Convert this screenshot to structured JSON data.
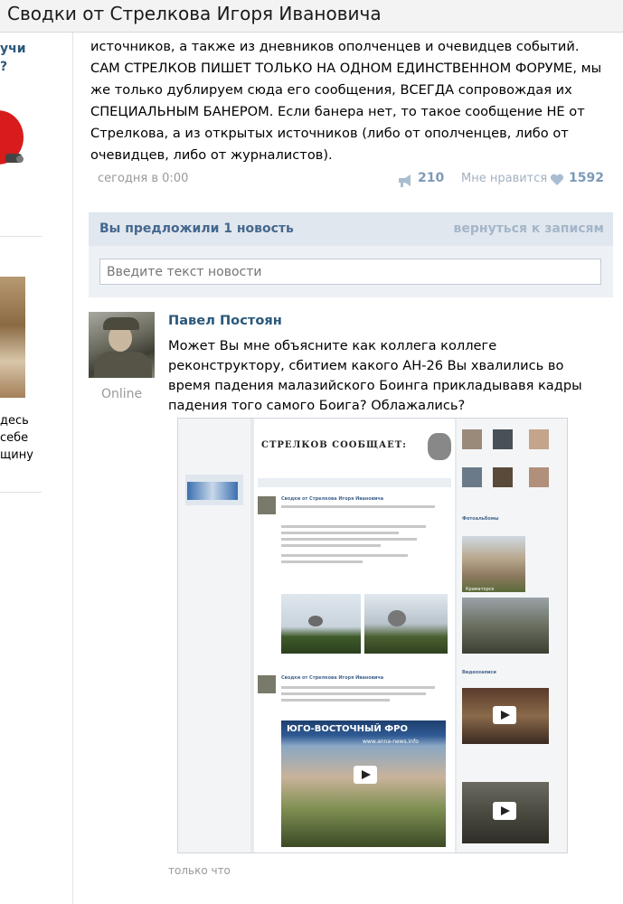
{
  "window": {
    "title": "Сводки от Стрелкова Игоря Ивановича"
  },
  "sidebar": {
    "link_lines": [
      "учи",
      "?"
    ],
    "text_lines": [
      "десь",
      "себе",
      "щину"
    ]
  },
  "post": {
    "text": "источников, а также из дневников ополченцев и очевидцев событий. САМ СТРЕЛКОВ ПИШЕТ ТОЛЬКО НА ОДНОМ ЕДИНСТВЕННОМ ФОРУМЕ, мы же только дублируем сюда его сообщения, ВСЕГДА сопровождая их СПЕЦИАЛЬНЫМ БАНЕРОМ. Если банера нет, то такое сообщение НЕ от Стрелкова, а из открытых источников (либо от ополченцев, либо от очевидцев, либо от журналистов).",
    "date": "сегодня в 0:00",
    "shares": "210",
    "like_label": "Мне нравится",
    "likes": "1592"
  },
  "suggest": {
    "title": "Вы предложили 1 новость",
    "back_link": "вернуться к записям",
    "input_placeholder": "Введите текст новости"
  },
  "comment": {
    "author": "Павел Постоян",
    "status": "Online",
    "text": "Может Вы мне объясните как коллега коллеге реконструктору, сбитием какого АН-26 Вы хвалились во время падения малазийского Боинга прикладывавя кадры падения того самого Боига? Облажались?",
    "time": "только что"
  },
  "screenshot": {
    "banner": "СТРЕЛКОВ СООБЩАЕТ:",
    "post1_author": "Сводки от Стрелкова Игоря Ивановича",
    "post2_author": "Сводки от Стрелкова Игоря Ивановича",
    "video_banner": "ЮГО-ВОСТОЧНЫЙ ФРО",
    "video_url": "www.anna-news.info",
    "photos_label": "Фотоальбомы",
    "photo_caption": "Краматорск",
    "videos_label": "Видеозаписи"
  },
  "colors": {
    "link": "#2b587a",
    "accent": "#45688e",
    "meta": "#999999",
    "panel": "#edf1f5"
  }
}
